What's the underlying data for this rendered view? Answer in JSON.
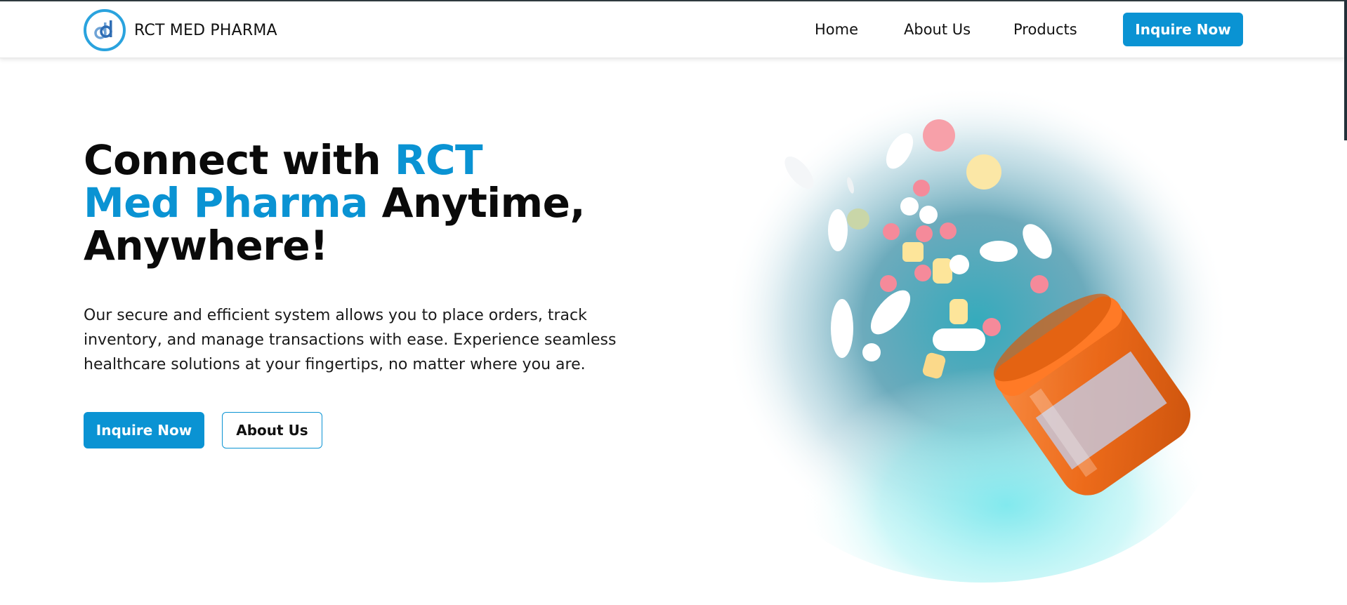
{
  "header": {
    "brand_name": "RCT MED PHARMA",
    "logo_icon": "dd-monogram-logo",
    "nav": [
      {
        "label": "Home"
      },
      {
        "label": "About Us"
      },
      {
        "label": "Products"
      }
    ],
    "cta_label": "Inquire Now"
  },
  "hero": {
    "title_part1": "Connect with ",
    "title_accent": "RCT Med Pharma",
    "title_part2": " Anytime, Anywhere!",
    "description": "Our secure and efficient system allows you to place orders, track inventory, and manage transactions with ease. Experience seamless healthcare solutions at your fingertips, no matter where you are.",
    "primary_button": "Inquire Now",
    "secondary_button": "About Us",
    "image_icon": "pill-bottle-spilling-pills-illustration"
  },
  "colors": {
    "accent": "#0a93d3",
    "text": "#0a0a0a",
    "background": "#ffffff"
  }
}
